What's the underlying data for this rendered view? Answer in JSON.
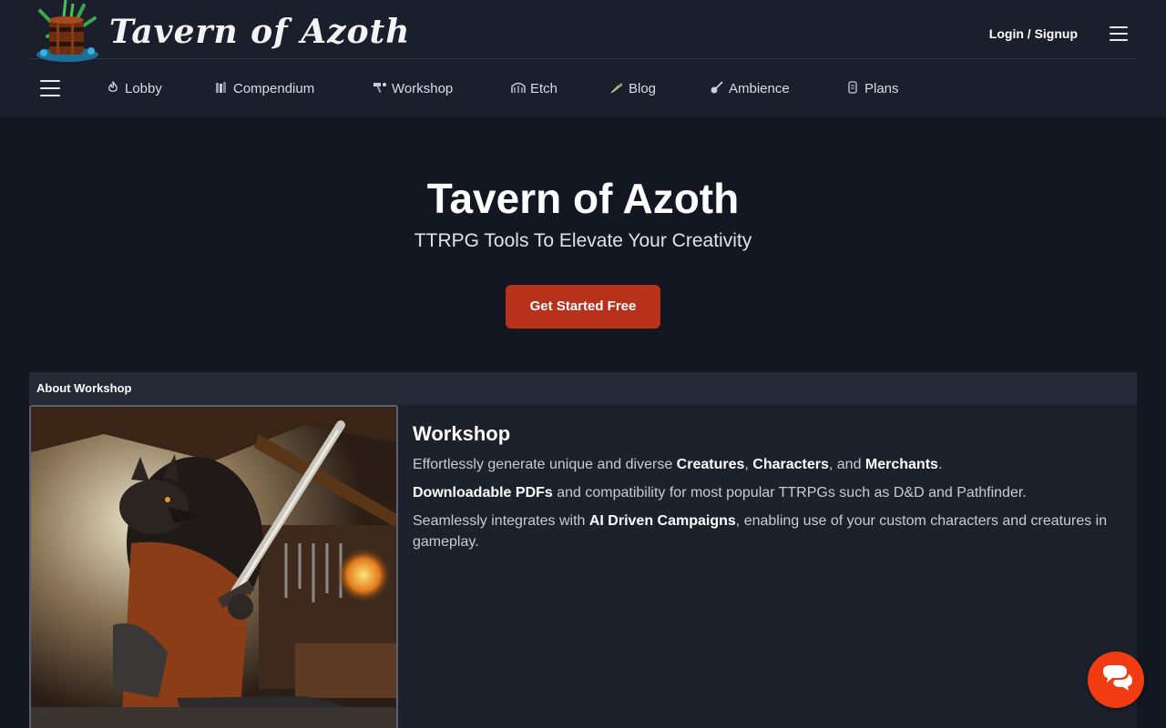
{
  "brand": {
    "title": "Tavern of Azoth"
  },
  "header": {
    "login_label": "Login / Signup"
  },
  "nav": {
    "items": [
      {
        "label": "Lobby",
        "icon": "flame-icon"
      },
      {
        "label": "Compendium",
        "icon": "books-icon"
      },
      {
        "label": "Workshop",
        "icon": "hammer-icon"
      },
      {
        "label": "Etch",
        "icon": "bridge-icon"
      },
      {
        "label": "Blog",
        "icon": "feather-icon"
      },
      {
        "label": "Ambience",
        "icon": "guitar-icon"
      },
      {
        "label": "Plans",
        "icon": "scroll-icon"
      }
    ]
  },
  "hero": {
    "title": "Tavern of Azoth",
    "subtitle": "TTRPG Tools To Elevate Your Creativity",
    "cta_label": "Get Started Free"
  },
  "about": {
    "header": "About Workshop",
    "title": "Workshop",
    "p1_a": "Effortlessly generate unique and diverse ",
    "p1_creatures": "Creatures",
    "p1_sep1": ", ",
    "p1_characters": "Characters",
    "p1_sep2": ", and ",
    "p1_merchants": "Merchants",
    "p1_end": ".",
    "p2_bold": "Downloadable PDFs",
    "p2_rest": " and compatibility for most popular TTRPGs such as D&D and Pathfinder.",
    "p3_a": "Seamlessly integrates with ",
    "p3_bold": "AI Driven Campaigns",
    "p3_rest": ", enabling use of your custom characters and creatures in gameplay."
  },
  "colors": {
    "background": "#131722",
    "header_bg": "#1b1f2b",
    "cta": "#b8311a",
    "chat": "#f13b12"
  }
}
